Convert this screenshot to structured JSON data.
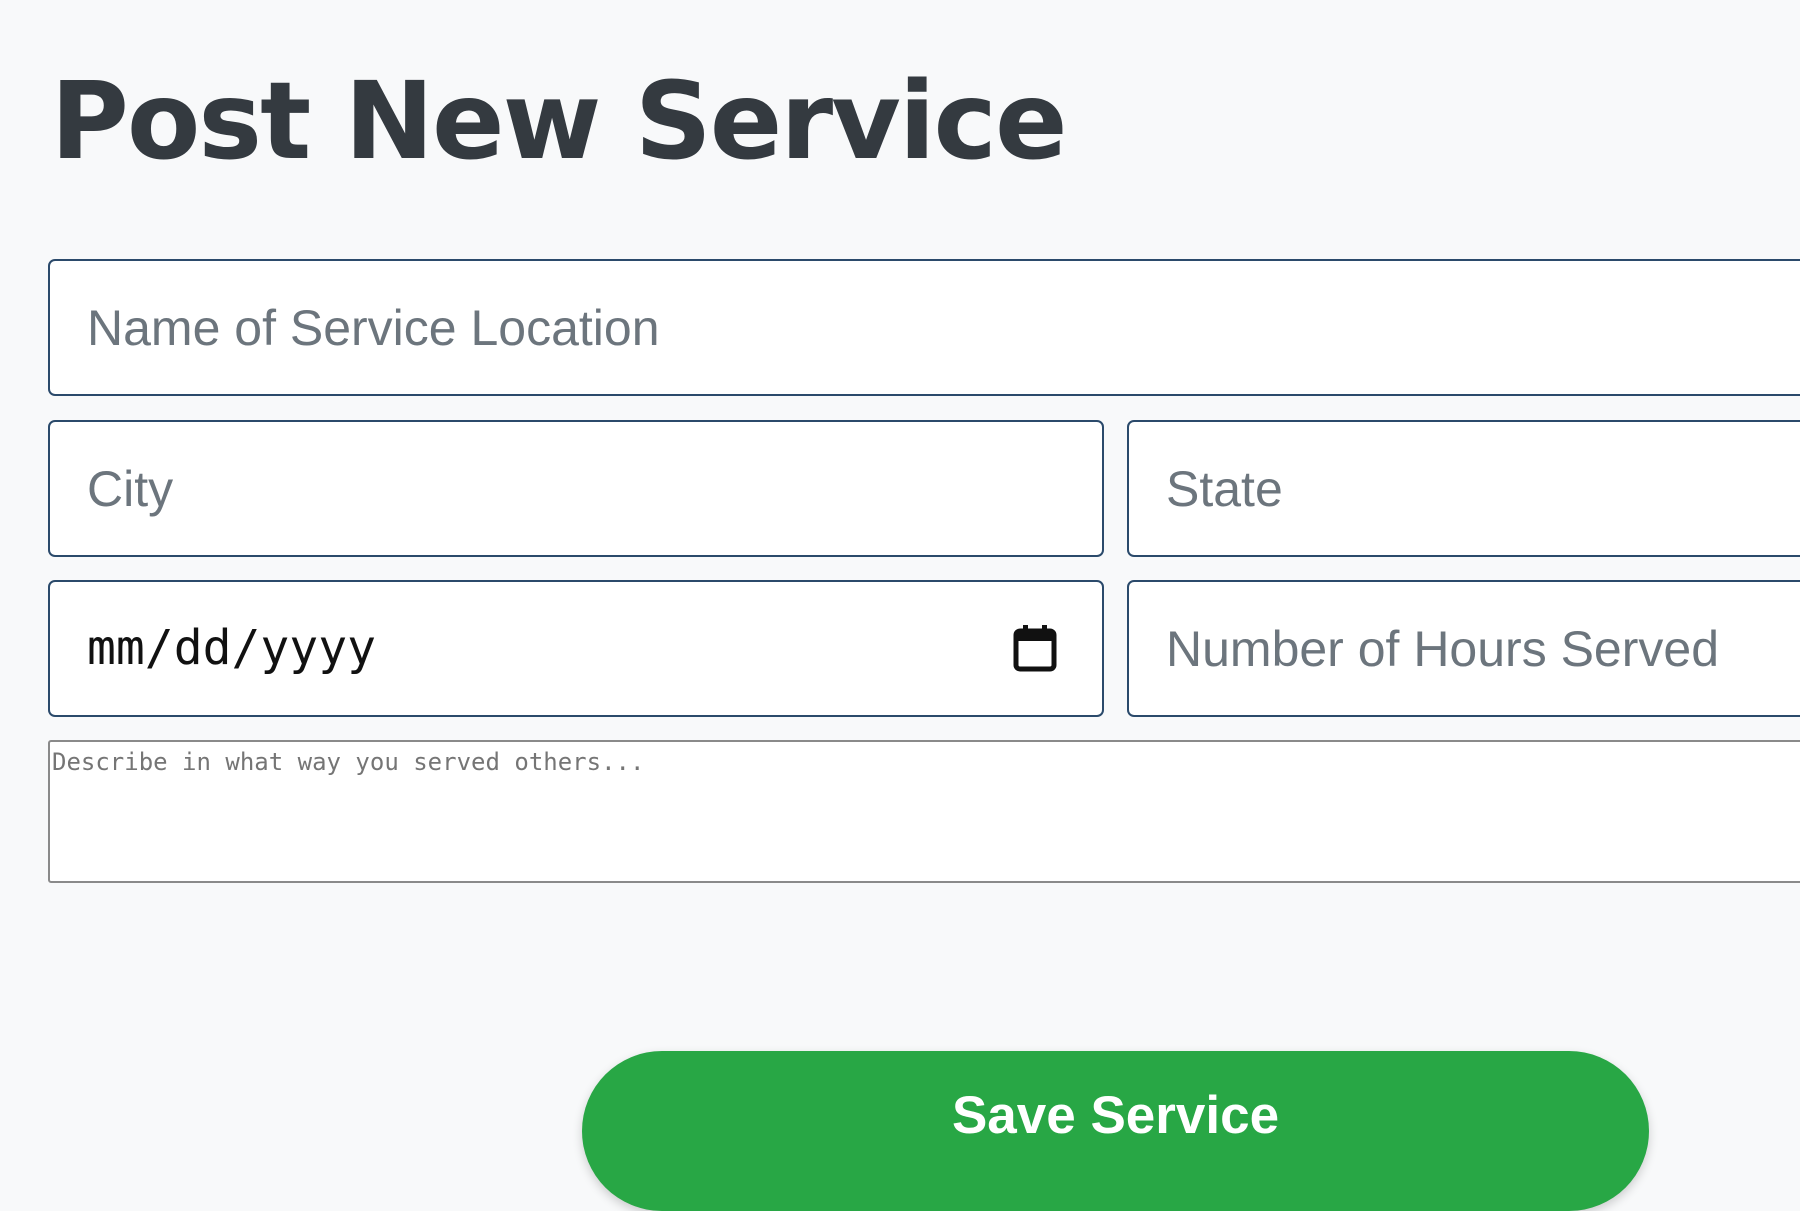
{
  "form": {
    "title": "Post New Service",
    "location_placeholder": "Name of Service Location",
    "city_placeholder": "City",
    "state_placeholder": "State",
    "date_placeholder": "mm/dd/yyyy",
    "hours_placeholder": "Number of Hours Served",
    "description_placeholder": "Describe in what way you served others...",
    "save_label": "Save Service"
  },
  "icons": {
    "date_picker": "calendar-icon"
  },
  "colors": {
    "background": "#f8f9fa",
    "title": "#343a40",
    "input_border": "#2b4a6b",
    "placeholder": "#6c757d",
    "save_button": "#28a745",
    "save_button_text": "#ffffff"
  }
}
